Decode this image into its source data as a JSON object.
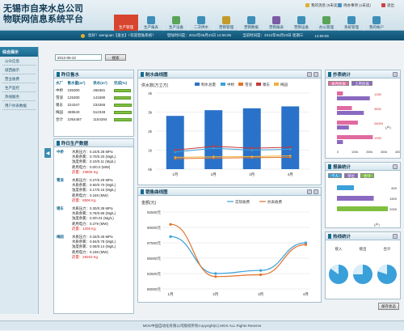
{
  "header": {
    "title": "无锡市自来水总公司\n物联网信息系统平台",
    "top_links": [
      "我的消息 (0未读)",
      "待办事项 (1未读)",
      "退出"
    ]
  },
  "nav": [
    {
      "label": "生产管理",
      "color": "#d8452f",
      "active": true
    },
    {
      "label": "生产报表",
      "color": "#3d8fb8"
    },
    {
      "label": "生产设备",
      "color": "#5aa45a"
    },
    {
      "label": "二次供水",
      "color": "#3d8fb8"
    },
    {
      "label": "营销管理",
      "color": "#c49a2b"
    },
    {
      "label": "营销数据",
      "color": "#3d8fb8"
    },
    {
      "label": "营销报表",
      "color": "#7b5aa4"
    },
    {
      "label": "营销设备",
      "color": "#3d8fb8"
    },
    {
      "label": "办公管理",
      "color": "#5aa45a"
    },
    {
      "label": "系统管理",
      "color": "#3d8fb8"
    },
    {
      "label": "我的帐户",
      "color": "#3d8fb8"
    }
  ],
  "infobar": {
    "greeting": "您好！wenguan【查主】! 欢迎登陆系统！",
    "last_login": "登陆时间是：2012年05月23日 14:55:06",
    "current_time": "当前时间是：2012年05月23日 星期三",
    "clock": "14:58:06"
  },
  "sidebar": {
    "header": "综合展示",
    "items": [
      "公众信息",
      "城西展示",
      "营业收费",
      "生产监控",
      "热线服务",
      "用户抄表数据"
    ]
  },
  "query": {
    "date_value": "2012-05-22",
    "button": "搜索"
  },
  "water_panel": {
    "title": "昨日售水",
    "columns": [
      "水厂",
      "售水量(m³)",
      "供水(m³)",
      "完成(%)"
    ],
    "rows": [
      {
        "name": "中桥",
        "a": "235300",
        "b": "266381",
        "pct": 0.82
      },
      {
        "name": "雪浪",
        "a": "125300",
        "b": "141590",
        "pct": 0.79
      },
      {
        "name": "锡东",
        "a": "224347",
        "b": "234365",
        "pct": 0.86
      },
      {
        "name": "梅园",
        "a": "469540",
        "b": "512348",
        "pct": 0.83
      },
      {
        "name": "合计",
        "a": "1054487",
        "b": "1154284",
        "pct": 0.84
      }
    ]
  },
  "production_panel": {
    "title": "昨日生产数据",
    "plants": [
      {
        "name": "中桥",
        "lines": [
          "水质压力：0.24/0.28 MPa",
          "水质余氯：0.70/0.20 (Mg/L)",
          "浊度余氯：0.10/0.11 (Mg/L)",
          "耗用电力：0.0/0.0 (MW)"
        ],
        "extra": "药量：23905 Kg"
      },
      {
        "name": "雪浪",
        "lines": [
          "水质压力：0.27/0.29 MPa",
          "水质余氯：0.60/0.70 (Mg/L)",
          "浊度余氯：0.17/0.15 (Mg/L)",
          "耗用电力：0.169 (MW)"
        ],
        "extra": "药量：8506 Kg"
      },
      {
        "name": "锡东",
        "lines": [
          "水质压力：0.30/0.39 MPa",
          "水质余氯：0.78/0.95 (Mg/L)",
          "浊度余氯：0.0/0.01 (Mg/L)",
          "耗用电力：0.279 (MW)"
        ],
        "extra": "药量：1205 Kg"
      },
      {
        "name": "梅园",
        "lines": [
          "水质压力：0.34/0.45 MPa",
          "水质余氯：0.94/0.78 (Mg/L)",
          "浊度余氯：0.08/0.14 (Mg/L)",
          "耗用电力：0.198 (MW)"
        ],
        "extra": "药量：29263 Kg"
      }
    ]
  },
  "chart_water": {
    "title": "制水曲线图",
    "ylabel": "供水数(万立方)",
    "legend": [
      "制水总量",
      "中桥",
      "雪浪",
      "锡东",
      "梅园"
    ],
    "legend_colors": [
      "#2a72c9",
      "#3aa0d9",
      "#e1732a",
      "#c63a3a",
      "#f0b23a"
    ]
  },
  "chart_sales": {
    "title": "销售曲线图",
    "ylabel": "金额(元)",
    "legend": [
      "实际收费",
      "抄表收费"
    ],
    "legend_colors": [
      "#3aa0d9",
      "#e1732a"
    ]
  },
  "meter_panel": {
    "title": "抄表统计",
    "tabs": [
      "本月抄表",
      "上月抄表"
    ],
    "values": [
      "1280",
      "3800",
      "28000",
      "1990",
      "2200",
      "15211",
      "2500",
      "12345",
      "40000"
    ],
    "unit": "(户)",
    "axis": [
      "0",
      "100k",
      "200k",
      "300k",
      "400k"
    ]
  },
  "repair_panel": {
    "title": "报装统计",
    "tabs": [
      "个人",
      "单位",
      "合计"
    ],
    "values": [
      "600",
      "1500",
      "2000"
    ],
    "unit": "(户)"
  },
  "hotline_panel": {
    "title": "热线统计",
    "labels": [
      "接入",
      "接出",
      "合计"
    ]
  },
  "footer": {
    "text": "MOX中国自动化有限公司版权所有Copyright(C) MOX ALL Rights Reserve",
    "save": "保存状态"
  },
  "chart_data": [
    {
      "type": "bar",
      "title": "制水曲线图",
      "ylabel": "供水数(万立方)",
      "categories": [
        "1月",
        "2月",
        "3月",
        "4月"
      ],
      "ylim": [
        0,
        4
      ],
      "series": [
        {
          "name": "制水总量",
          "values": [
            2.8,
            3.1,
            3.2,
            3.3
          ]
        },
        {
          "name": "中桥",
          "values": [
            0.9,
            1.1,
            1.0,
            1.05
          ]
        },
        {
          "name": "雪浪",
          "values": [
            0.55,
            0.58,
            0.6,
            0.62
          ]
        },
        {
          "name": "锡东",
          "values": [
            1.0,
            1.2,
            1.1,
            1.15
          ]
        },
        {
          "name": "梅园",
          "values": [
            0.62,
            0.65,
            0.66,
            0.7
          ]
        }
      ]
    },
    {
      "type": "line",
      "title": "销售曲线图",
      "ylabel": "金额(元)",
      "categories": [
        "1月",
        "2月",
        "3月",
        "4月"
      ],
      "ylim": [
        80000,
        92500
      ],
      "series": [
        {
          "name": "实际收费",
          "values": [
            88500,
            82500,
            83000,
            87500
          ]
        },
        {
          "name": "抄表收费",
          "values": [
            90500,
            82000,
            82300,
            87200
          ]
        }
      ]
    }
  ]
}
